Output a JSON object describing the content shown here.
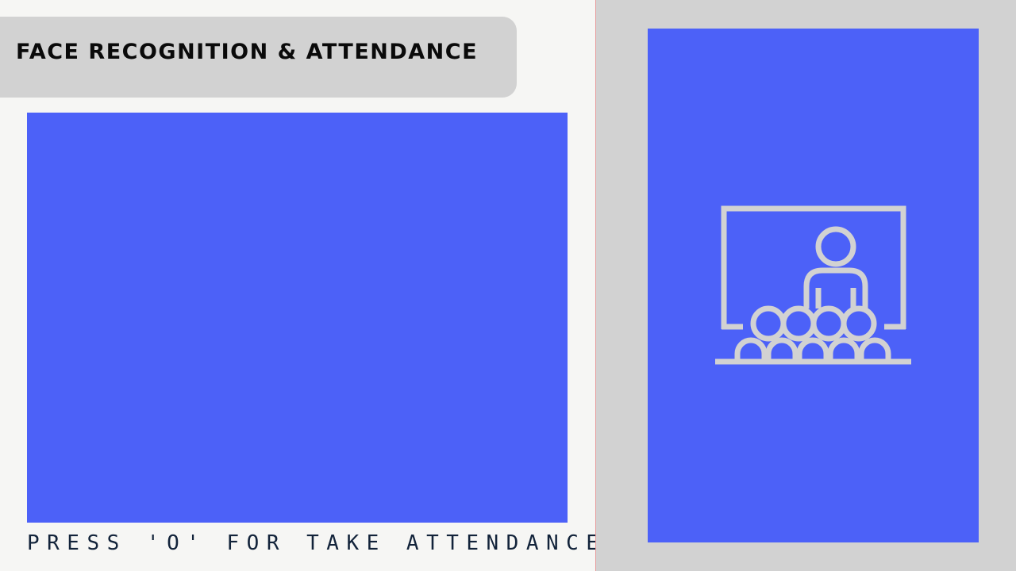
{
  "header": {
    "title": "FACE RECOGNITION & ATTENDANCE"
  },
  "camera": {
    "hint": "PRESS 'O' FOR TAKE ATTENDANCE"
  },
  "status_panel": {
    "icon": "classroom-icon"
  },
  "colors": {
    "background": "#f6f6f4",
    "panel_gray": "#d2d2d2",
    "accent_blue": "#4c61f8",
    "divider": "#e69a9a",
    "title_text": "#0a0a0a",
    "hint_text": "#12233a"
  }
}
